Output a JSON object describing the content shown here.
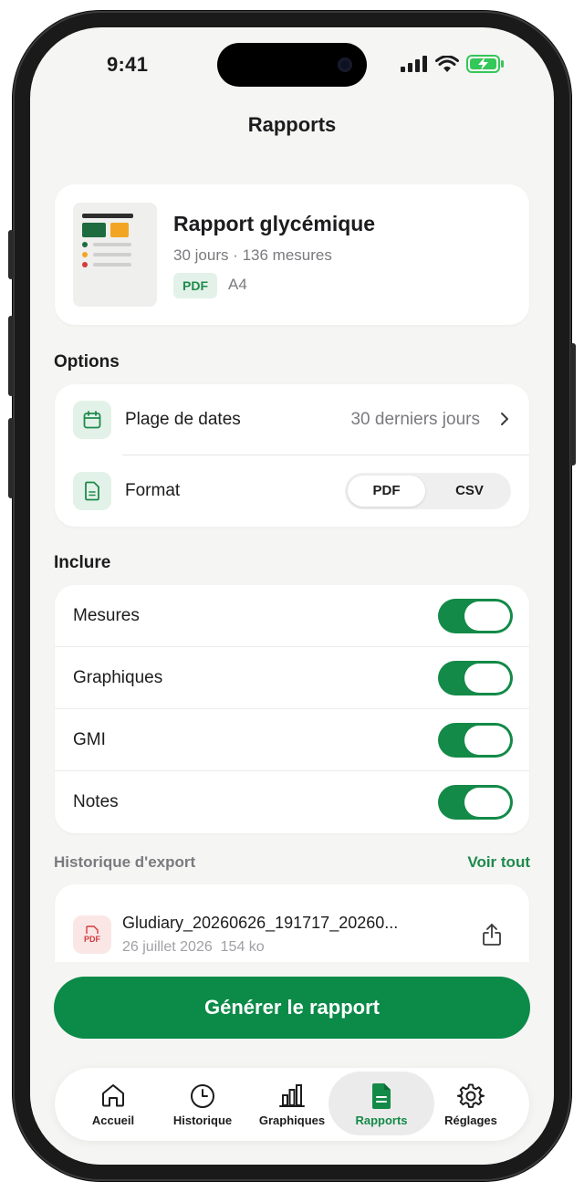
{
  "status": {
    "time": "9:41"
  },
  "header": {
    "title": "Rapports"
  },
  "report": {
    "title": "Rapport glycémique",
    "subtitle": "30 jours · 136 mesures",
    "format_badge": "PDF",
    "paper": "A4"
  },
  "options": {
    "section": "Options",
    "date_range": {
      "label": "Plage de dates",
      "value": "30 derniers jours"
    },
    "format": {
      "label": "Format",
      "options": [
        "PDF",
        "CSV"
      ],
      "selected": "PDF"
    }
  },
  "include": {
    "section": "Inclure",
    "items": [
      {
        "label": "Mesures",
        "on": true
      },
      {
        "label": "Graphiques",
        "on": true
      },
      {
        "label": "GMI",
        "on": true
      },
      {
        "label": "Notes",
        "on": true
      }
    ]
  },
  "history": {
    "section": "Historique d'export",
    "see_all": "Voir tout",
    "items": [
      {
        "icon_label": "PDF",
        "name": "Gludiary_20260626_191717_20260...",
        "date": "26 juillet 2026",
        "size": "154 ko"
      }
    ]
  },
  "cta": {
    "label": "Générer le rapport"
  },
  "tabs": [
    {
      "label": "Accueil",
      "icon": "home-icon",
      "active": false
    },
    {
      "label": "Historique",
      "icon": "clock-icon",
      "active": false
    },
    {
      "label": "Graphiques",
      "icon": "bar-chart-icon",
      "active": false
    },
    {
      "label": "Rapports",
      "icon": "document-icon",
      "active": true
    },
    {
      "label": "Réglages",
      "icon": "gear-icon",
      "active": false
    }
  ],
  "colors": {
    "accent": "#138a48",
    "accent_light": "#e3f2e8",
    "background": "#f5f5f3",
    "pdf_red": "#d33a3a"
  }
}
